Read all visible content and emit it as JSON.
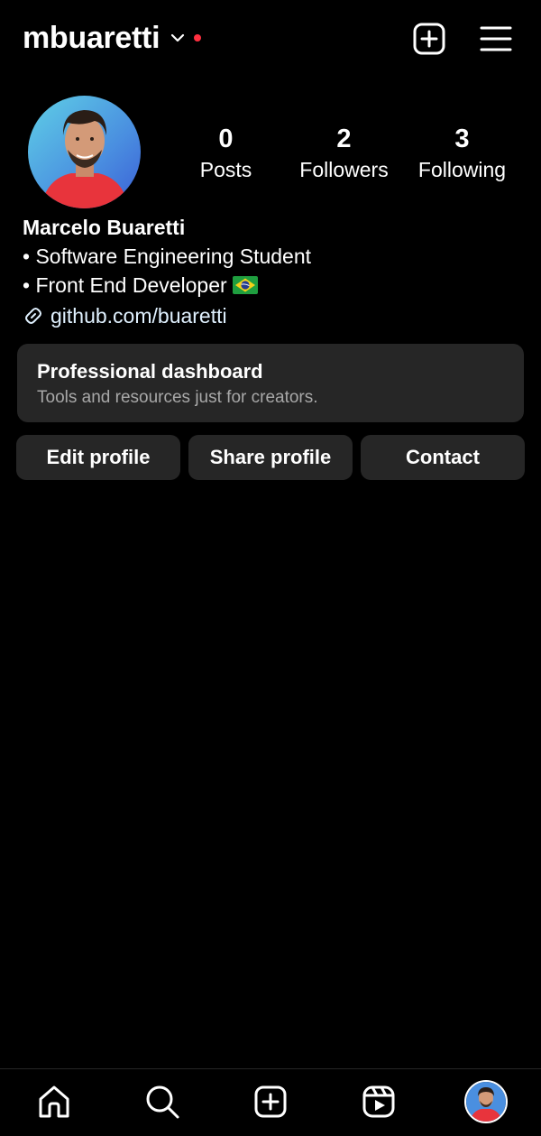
{
  "header": {
    "username": "mbuaretti",
    "icons": {
      "account_switch": "chevron-down-icon",
      "notification": "notification-dot",
      "new_post": "plus-square-icon",
      "menu": "hamburger-menu-icon"
    },
    "notification_color": "#ff3040"
  },
  "profile": {
    "avatar_icon": "profile-photo",
    "stats": [
      {
        "value": "0",
        "label": "Posts"
      },
      {
        "value": "2",
        "label": "Followers"
      },
      {
        "value": "3",
        "label": "Following"
      }
    ],
    "name": "Marcelo Buaretti",
    "bio_lines": [
      "• Software Engineering Student",
      "• Front End Developer"
    ],
    "bio_emoji": "brazil-flag",
    "link_icon": "link-icon",
    "link": "github.com/buaretti"
  },
  "dashboard": {
    "title": "Professional dashboard",
    "subtitle": "Tools and resources just for creators."
  },
  "actions": {
    "edit": "Edit profile",
    "share": "Share profile",
    "contact": "Contact"
  },
  "bottom_nav": {
    "items": [
      "home-icon",
      "search-icon",
      "create-icon",
      "reels-icon",
      "profile-avatar"
    ]
  },
  "colors": {
    "background": "#000000",
    "surface": "#262626",
    "secondary_text": "#a8a8a8",
    "link_text": "#e0f1ff"
  }
}
